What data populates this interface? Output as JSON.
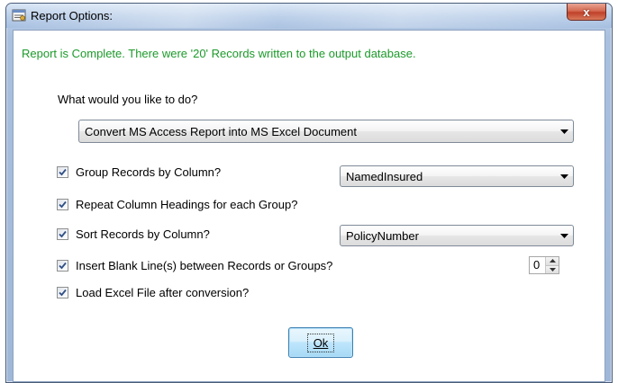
{
  "window": {
    "title": "Report Options:",
    "close_label": "x"
  },
  "status_message": "Report is Complete.  There were '20' Records written to the output database.",
  "question": "What would you like to do?",
  "action_select": {
    "value": "Convert MS Access Report into MS Excel Document"
  },
  "options": {
    "group_by": {
      "label": "Group Records by Column?",
      "checked": true,
      "select_value": "NamedInsured"
    },
    "repeat_headings": {
      "label": "Repeat Column Headings for each Group?",
      "checked": true
    },
    "sort_by": {
      "label": "Sort Records by Column?",
      "checked": true,
      "select_value": "PolicyNumber"
    },
    "blank_lines": {
      "label": "Insert Blank Line(s) between Records or Groups?",
      "checked": true,
      "spinner_value": "0"
    },
    "load_excel": {
      "label": "Load Excel File after conversion?",
      "checked": true
    }
  },
  "ok_button": {
    "label": "Ok"
  },
  "colors": {
    "status_text": "#1c9a2a",
    "checkmark": "#2f4f86",
    "close_button": "#c0412a"
  },
  "icons": {
    "title": "report-window-icon",
    "dropdown": "chevron-down-icon",
    "check": "checkmark-icon",
    "spin_up": "spin-up-icon",
    "spin_down": "spin-down-icon",
    "close": "close-icon"
  }
}
